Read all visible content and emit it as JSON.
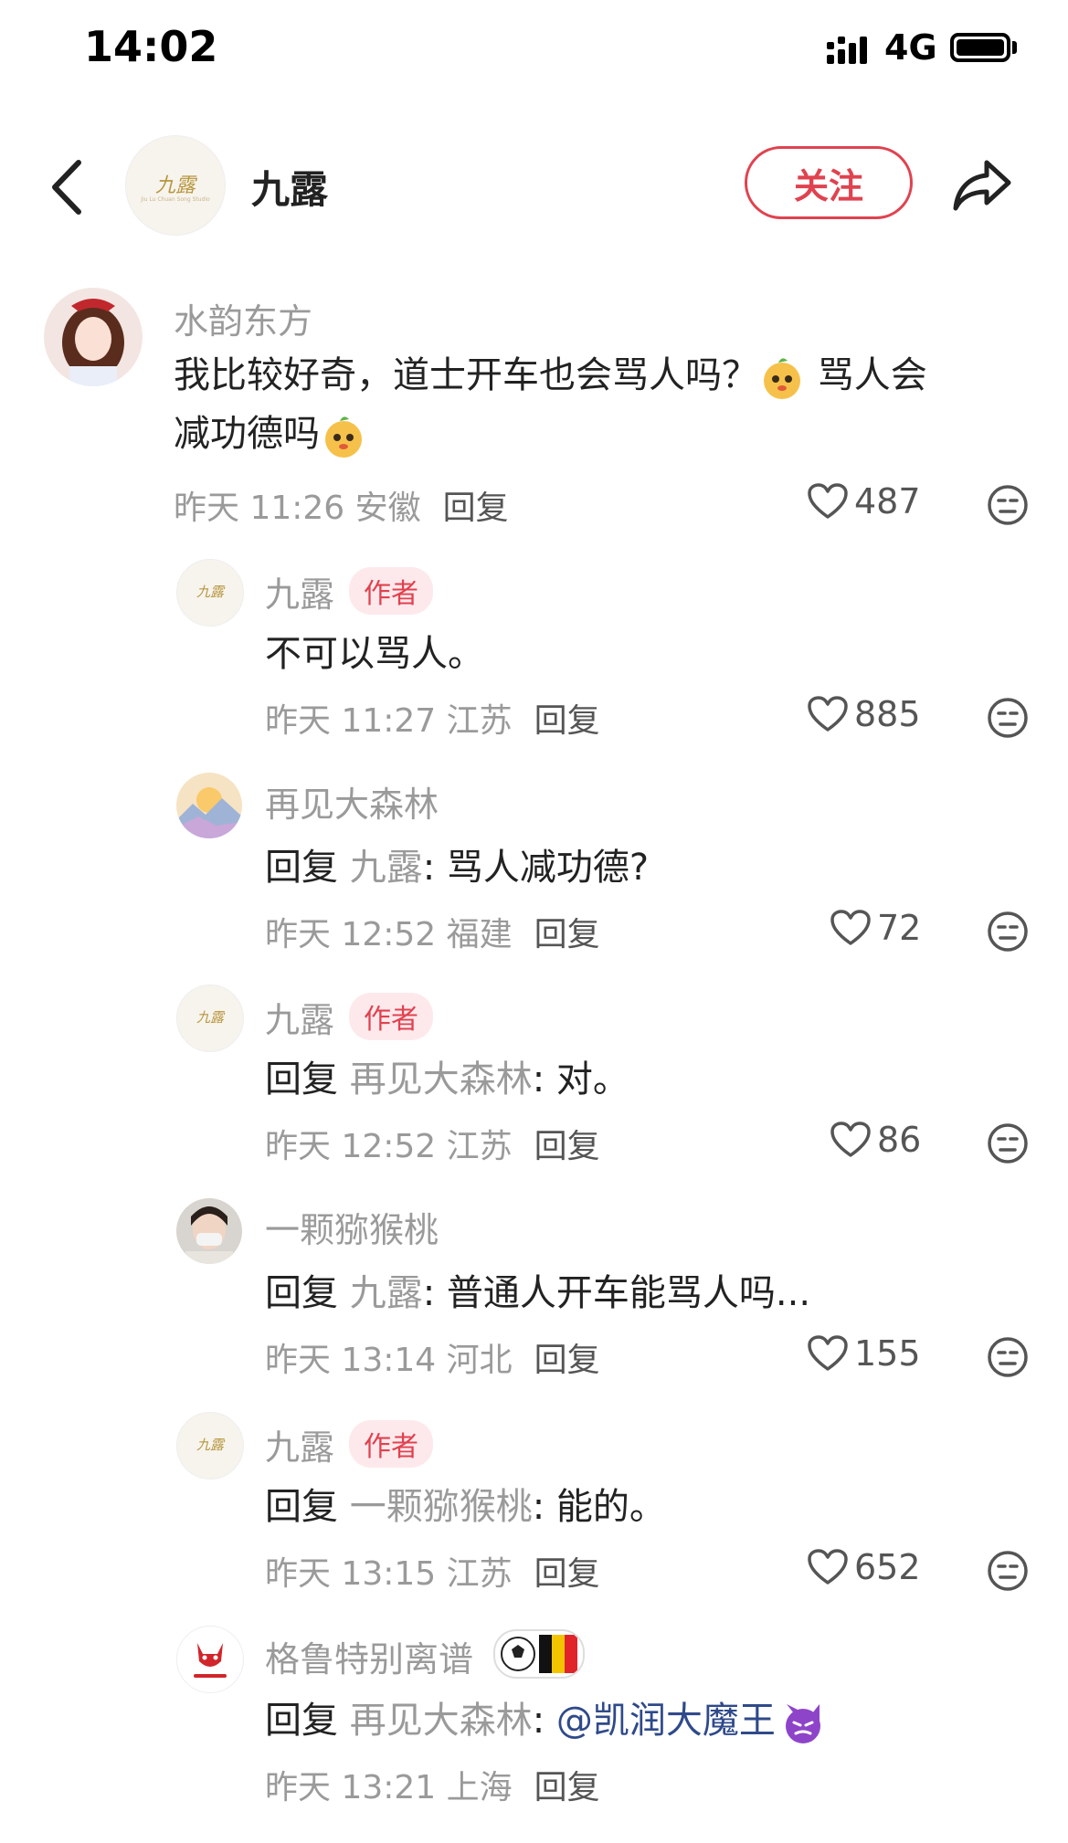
{
  "status_bar": {
    "time": "14:02",
    "network": "4G"
  },
  "header": {
    "name": "九露",
    "follow_label": "关注",
    "logo_text": "九露",
    "logo_sub": "Jiu Lu Chuan Song Studio"
  },
  "comments": [
    {
      "author": "水韵东方",
      "text_part1": "我比较好奇，道士开车也会骂人吗？",
      "text_part2": " 骂人会",
      "text_part3": "减功德吗",
      "time": "昨天 11:26 安徽",
      "reply_label": "回复",
      "likes": "487"
    },
    {
      "author": "九露",
      "badge": "作者",
      "text": "不可以骂人。",
      "time": "昨天 11:27 江苏",
      "reply_label": "回复",
      "likes": "885"
    },
    {
      "author": "再见大森林",
      "reply_prefix": "回复 ",
      "reply_to": "九露",
      "text": ": 骂人减功德?",
      "time": "昨天 12:52 福建",
      "reply_label": "回复",
      "likes": "72"
    },
    {
      "author": "九露",
      "badge": "作者",
      "reply_prefix": "回复 ",
      "reply_to": "再见大森林",
      "text": ": 对。",
      "time": "昨天 12:52 江苏",
      "reply_label": "回复",
      "likes": "86"
    },
    {
      "author": "一颗猕猴桃",
      "reply_prefix": "回复 ",
      "reply_to": "九露",
      "text": ": 普通人开车能骂人吗...",
      "time": "昨天 13:14 河北",
      "reply_label": "回复",
      "likes": "155"
    },
    {
      "author": "九露",
      "badge": "作者",
      "reply_prefix": "回复 ",
      "reply_to": "一颗猕猴桃",
      "text": ": 能的。",
      "time": "昨天 13:15 江苏",
      "reply_label": "回复",
      "likes": "652"
    },
    {
      "author": "格鲁特别离谱",
      "reply_prefix": "回复 ",
      "reply_to": "再见大森林",
      "text_sep": ": ",
      "mention": "@凯润大魔王",
      "time": "昨天 13:21 上海",
      "reply_label": "回复"
    }
  ],
  "colors": {
    "accent": "#e0424f",
    "muted": "#9a9a9a",
    "mention": "#2f4a8a"
  }
}
